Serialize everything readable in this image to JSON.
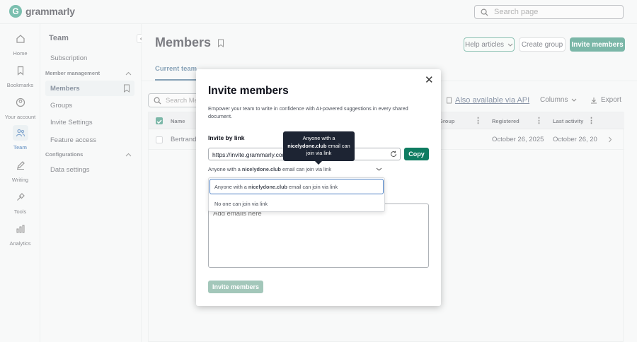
{
  "brand": {
    "name": "grammarly",
    "logo_letter": "G"
  },
  "topbar": {
    "search_placeholder": "Search page"
  },
  "rail": [
    {
      "label": "Home",
      "icon": "home-icon"
    },
    {
      "label": "Bookmarks",
      "icon": "bookmark-icon"
    },
    {
      "label": "Your account",
      "icon": "account-icon"
    },
    {
      "label": "Team",
      "icon": "team-icon",
      "active": true
    },
    {
      "label": "Writing",
      "icon": "pen-icon"
    },
    {
      "label": "Tools",
      "icon": "tools-icon"
    },
    {
      "label": "Analytics",
      "icon": "analytics-icon"
    }
  ],
  "subnav": {
    "title": "Team",
    "subscription": "Subscription",
    "section_member_management": "Member management",
    "members": "Members",
    "groups": "Groups",
    "invite_settings": "Invite Settings",
    "feature_access": "Feature access",
    "section_configurations": "Configurations",
    "data_settings": "Data settings"
  },
  "main": {
    "title": "Members",
    "help_articles": "Help articles",
    "create_group": "Create group",
    "invite_members": "Invite members",
    "tab_current": "Current team",
    "search_placeholder": "Search Me",
    "api_link": "Also available via API",
    "columns": "Columns",
    "export": "Export",
    "table": {
      "headers": {
        "name": "Name",
        "group": "Group",
        "registered": "Registered",
        "last_activity": "Last activity"
      },
      "rows": [
        {
          "name": "Bertrand",
          "registered": "October 26, 2025",
          "last_activity": "October 26, 20"
        }
      ]
    }
  },
  "modal": {
    "title": "Invite members",
    "description": "Empower your team to write in confidence with AI-powered suggestions in every shared document.",
    "invite_by_link_label": "Invite by link",
    "link_value": "https://invite.grammarly.com",
    "copy": "Copy",
    "select_prefix": "Anyone with a ",
    "select_domain": "nicelydone.club",
    "select_suffix": " email can join via link",
    "option_1_prefix": "Anyone with a ",
    "option_1_domain": "nicelydone.club",
    "option_1_suffix": " email can join via link",
    "option_2": "No one can join via link",
    "emails_placeholder": "Add emails here",
    "submit": "Invite members",
    "accent_color": "#0f7c61"
  },
  "tooltip": {
    "line1": "Anyone with a",
    "domain": "nicelydone.club",
    "line2_suffix": " email can",
    "line3": "join via link"
  }
}
